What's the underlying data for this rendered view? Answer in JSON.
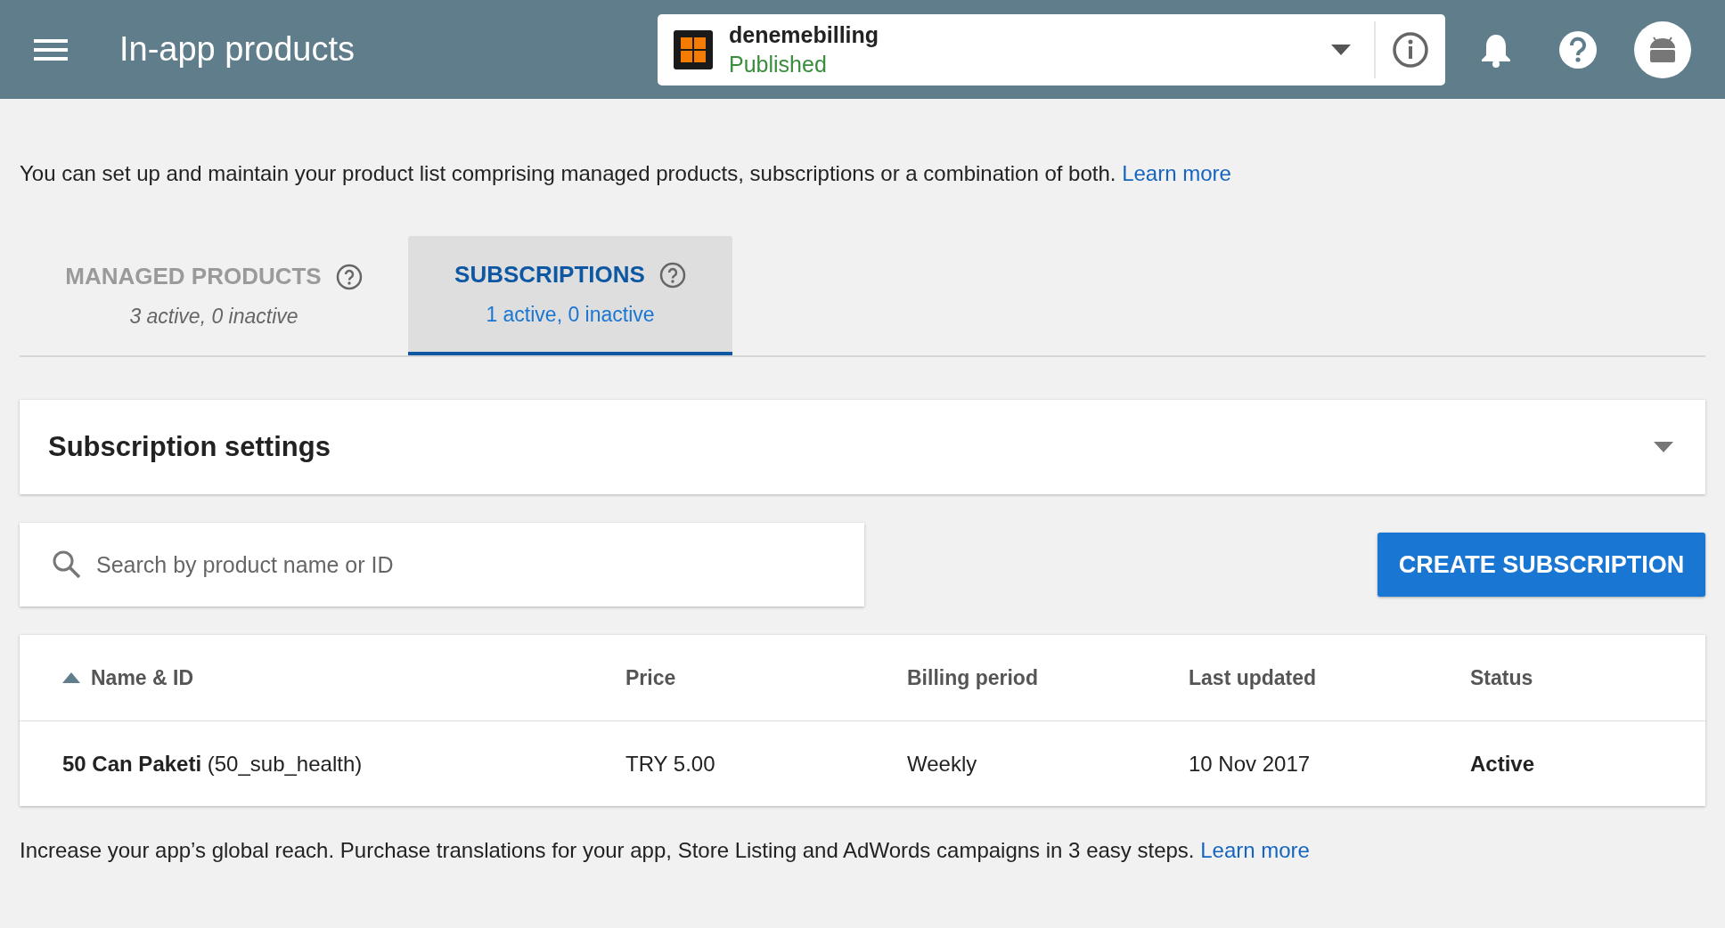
{
  "header": {
    "title": "In-app products",
    "app": {
      "name": "denemebilling",
      "status": "Published"
    }
  },
  "intro": {
    "text": "You can set up and maintain your product list comprising managed products, subscriptions or a combination of both.",
    "link": "Learn more"
  },
  "tabs": [
    {
      "label": "MANAGED PRODUCTS",
      "counts": "3 active, 0 inactive",
      "selected": false
    },
    {
      "label": "SUBSCRIPTIONS",
      "counts": "1 active, 0 inactive",
      "selected": true
    }
  ],
  "settings_panel": {
    "title": "Subscription settings",
    "expanded": false
  },
  "search": {
    "placeholder": "Search by product name or ID"
  },
  "create_button": "CREATE SUBSCRIPTION",
  "table": {
    "columns": [
      {
        "label": "Name & ID",
        "sorted": true
      },
      {
        "label": "Price",
        "sorted": false
      },
      {
        "label": "Billing period",
        "sorted": false
      },
      {
        "label": "Last updated",
        "sorted": false
      },
      {
        "label": "Status",
        "sorted": false
      }
    ],
    "rows": [
      [
        "**50 Can Paketi** (50_sub_health)",
        "TRY 5.00",
        "Weekly",
        "10 Nov 2017",
        "Active"
      ]
    ]
  },
  "footer": {
    "text": "Increase your app’s global reach. Purchase translations for your app, Store Listing and AdWords campaigns in 3 easy steps.",
    "link": "Learn more"
  }
}
